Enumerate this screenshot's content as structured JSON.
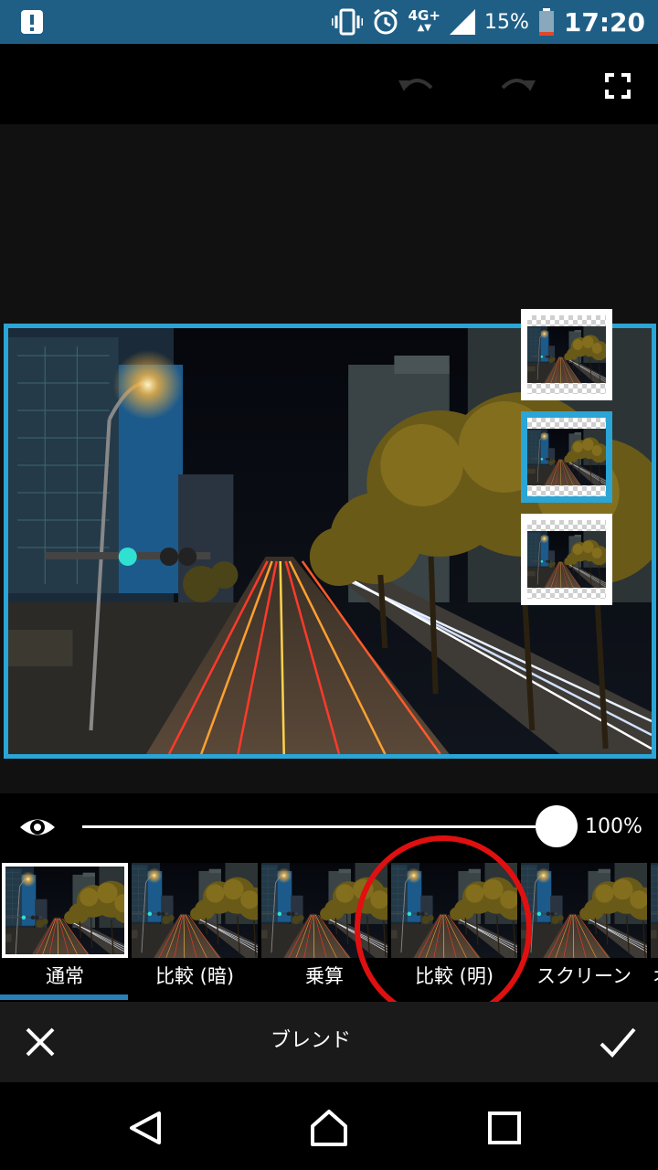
{
  "status_bar": {
    "battery_percent": "15%",
    "network": "4G+",
    "time": "17:20",
    "background_color": "#1f5f86",
    "icons": [
      "alert-icon",
      "vibrate-icon",
      "alarm-icon",
      "network-4g-icon",
      "signal-icon",
      "battery-icon"
    ]
  },
  "toolbar": {
    "icons": [
      "undo-icon",
      "redo-icon",
      "fullscreen-icon"
    ]
  },
  "canvas": {
    "selection_color": "#2aa5d6",
    "layers_count": 3,
    "selected_layer": 2
  },
  "opacity": {
    "value_label": "100%",
    "value": 1.0
  },
  "blend_modes": {
    "items": [
      {
        "label": "通常",
        "active": true
      },
      {
        "label": "比較 (暗)",
        "active": false
      },
      {
        "label": "乗算",
        "active": false
      },
      {
        "label": "比較 (明)",
        "active": false,
        "highlighted": true
      },
      {
        "label": "スクリーン",
        "active": false
      },
      {
        "label": "オ",
        "active": false
      }
    ],
    "indicator_color": "#2a7fb8",
    "highlight_color": "#e01010"
  },
  "action_bar": {
    "title": "ブレンド",
    "cancel_icon": "close-icon",
    "confirm_icon": "check-icon"
  },
  "nav_bar": {
    "icons": [
      "back-icon",
      "home-icon",
      "recents-icon"
    ]
  }
}
